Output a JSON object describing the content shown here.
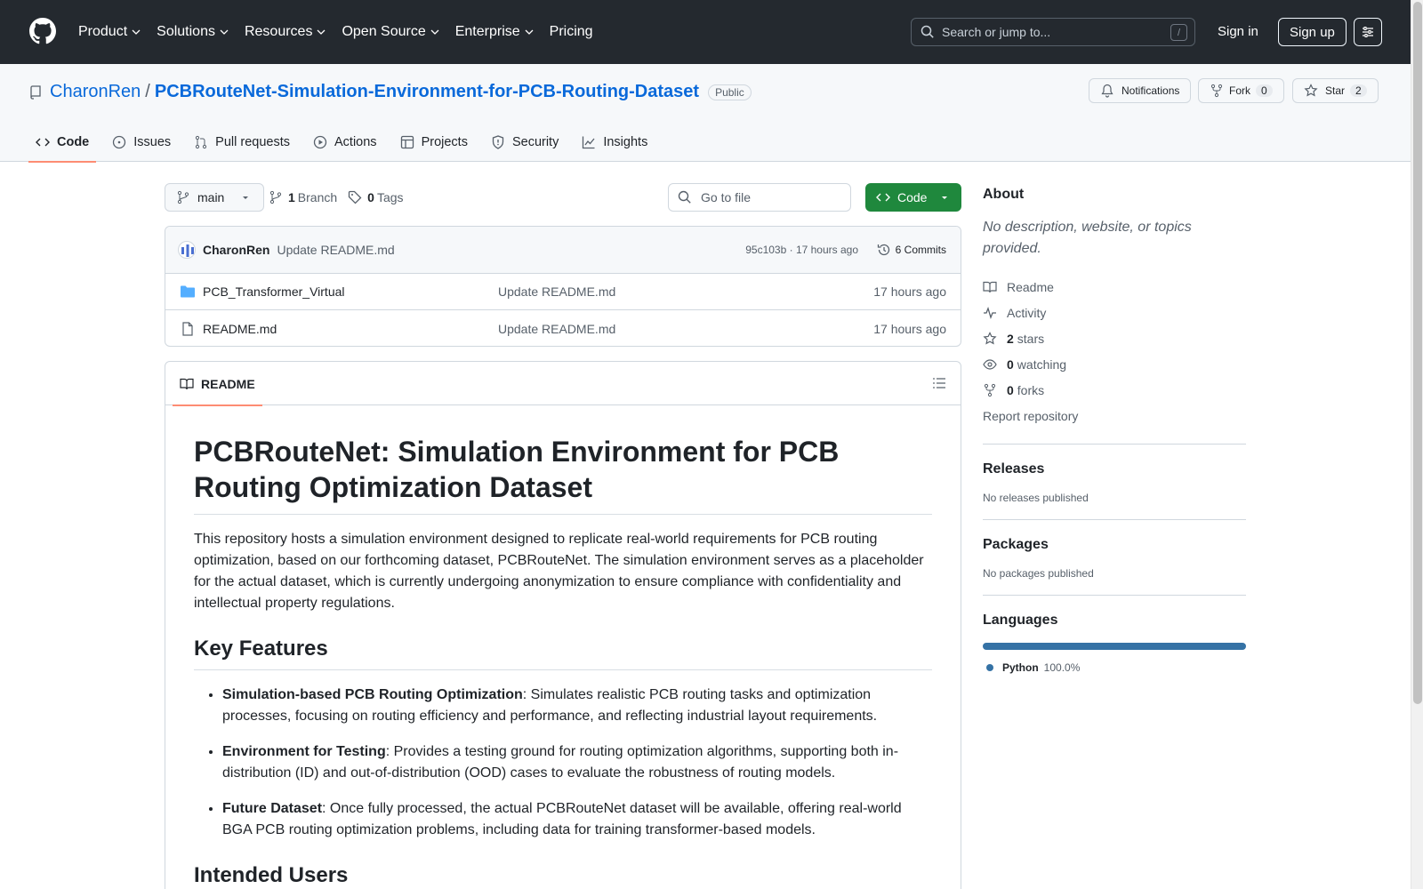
{
  "topnav": {
    "items": [
      "Product",
      "Solutions",
      "Resources",
      "Open Source",
      "Enterprise",
      "Pricing"
    ],
    "search_placeholder": "Search or jump to...",
    "search_shortcut": "/",
    "signin": "Sign in",
    "signup": "Sign up"
  },
  "repo": {
    "owner": "CharonRen",
    "separator": "/",
    "name": "PCBRouteNet-Simulation-Environment-for-PCB-Routing-Dataset",
    "visibility": "Public",
    "notifications_label": "Notifications",
    "fork_label": "Fork",
    "fork_count": "0",
    "star_label": "Star",
    "star_count": "2"
  },
  "tabs": [
    "Code",
    "Issues",
    "Pull requests",
    "Actions",
    "Projects",
    "Security",
    "Insights"
  ],
  "branch": {
    "current": "main",
    "branch_count": "1",
    "branch_label": "Branch",
    "tag_count": "0",
    "tag_label": "Tags",
    "goto_placeholder": "Go to file",
    "code_button": "Code"
  },
  "latest_commit": {
    "author": "CharonRen",
    "message": "Update README.md",
    "meta": "95c103b · 17 hours ago",
    "commits": "6 Commits"
  },
  "files": [
    {
      "type": "folder",
      "name": "PCB_Transformer_Virtual",
      "message": "Update README.md",
      "age": "17 hours ago"
    },
    {
      "type": "file",
      "name": "README.md",
      "message": "Update README.md",
      "age": "17 hours ago"
    }
  ],
  "readme": {
    "tab_label": "README",
    "title": "PCBRouteNet: Simulation Environment for PCB Routing Optimization Dataset",
    "intro": "This repository hosts a simulation environment designed to replicate real-world requirements for PCB routing optimization, based on our forthcoming dataset, PCBRouteNet. The simulation environment serves as a placeholder for the actual dataset, which is currently undergoing anonymization to ensure compliance with confidentiality and intellectual property regulations.",
    "h2_features": "Key Features",
    "features": [
      {
        "bold": "Simulation-based PCB Routing Optimization",
        "text": ": Simulates realistic PCB routing tasks and optimization processes, focusing on routing efficiency and performance, and reflecting industrial layout requirements."
      },
      {
        "bold": "Environment for Testing",
        "text": ": Provides a testing ground for routing optimization algorithms, supporting both in-distribution (ID) and out-of-distribution (OOD) cases to evaluate the robustness of routing models."
      },
      {
        "bold": "Future Dataset",
        "text": ": Once fully processed, the actual PCBRouteNet dataset will be available, offering real-world BGA PCB routing optimization problems, including data for training transformer-based models."
      }
    ],
    "h2_users": "Intended Users"
  },
  "about": {
    "heading": "About",
    "description": "No description, website, or topics provided.",
    "readme": "Readme",
    "activity": "Activity",
    "stars_count": "2",
    "stars_label": "stars",
    "watching_count": "0",
    "watching_label": "watching",
    "forks_count": "0",
    "forks_label": "forks",
    "report": "Report repository"
  },
  "releases": {
    "heading": "Releases",
    "text": "No releases published"
  },
  "packages": {
    "heading": "Packages",
    "text": "No packages published"
  },
  "languages": {
    "heading": "Languages",
    "name": "Python",
    "percent": "100.0%",
    "color": "#3572A5"
  }
}
